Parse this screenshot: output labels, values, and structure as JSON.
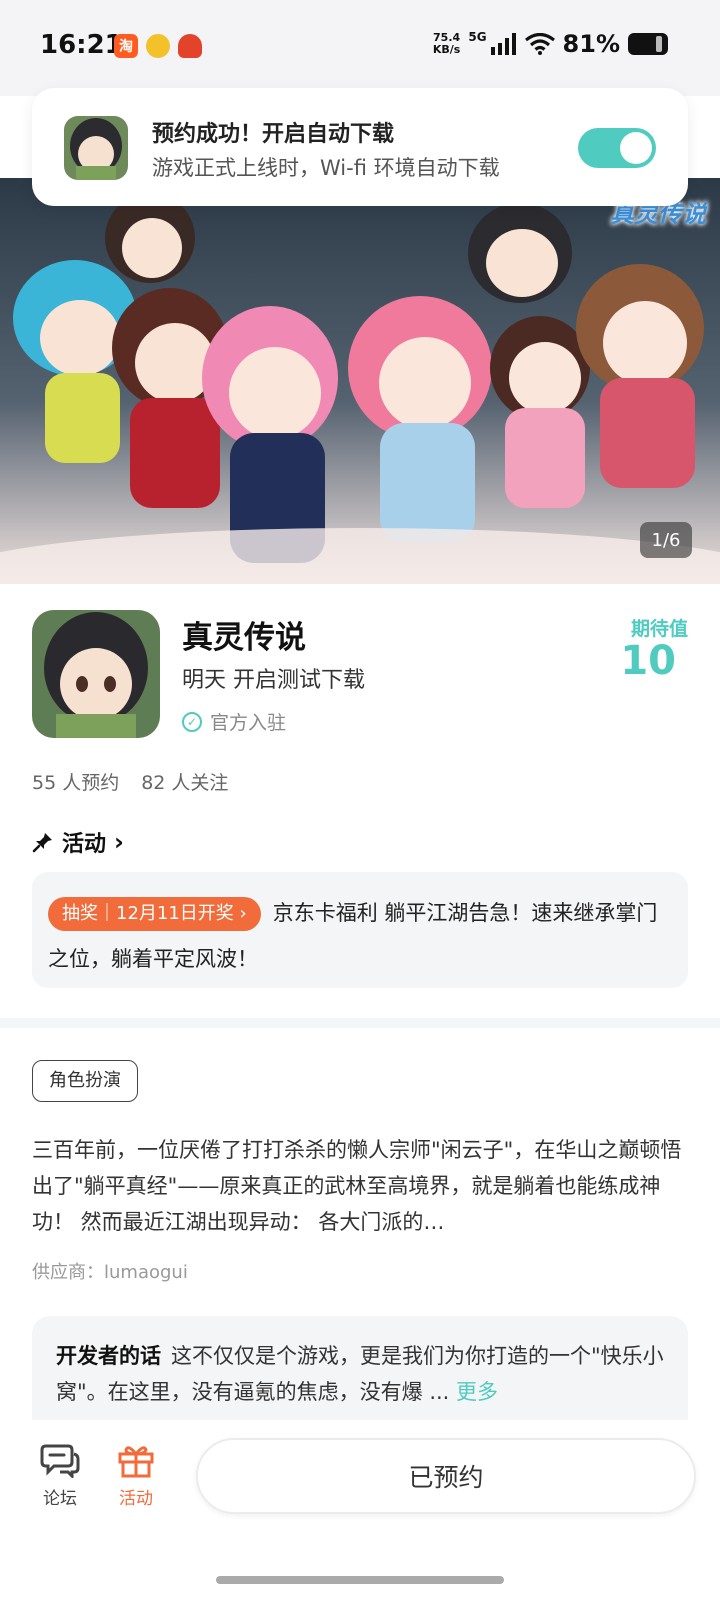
{
  "status_bar": {
    "time": "16:21",
    "speed_value": "75.4",
    "speed_unit": "KB/s",
    "network": "5G",
    "battery": "81%"
  },
  "notification": {
    "title": "预约成功！开启自动下载",
    "subtitle": "游戏正式上线时，Wi-fi 环境自动下载",
    "toggle_on": true,
    "accent": "#4fcbbf"
  },
  "banner": {
    "logo_text": "真灵传说",
    "pager": "1/6"
  },
  "game": {
    "name": "真灵传说",
    "status": "明天 开启测试下载",
    "official_label": "官方入驻",
    "expect_label": "期待值",
    "expect_value": "10",
    "reservations": "55 人预约",
    "followers": "82 人关注"
  },
  "activity": {
    "heading": "活动",
    "tag": "抽奖｜12月11日开奖",
    "text": "京东卡福利 躺平江湖告急！速来继承掌门之位，躺着平定风波！",
    "tag_color": "#f26b3a"
  },
  "details": {
    "genre_tag": "角色扮演",
    "description": "三百年前，一位厌倦了打打杀杀的懒人宗师\"闲云子\"，在华山之巅顿悟出了\"躺平真经\"——原来真正的武林至高境界，就是躺着也能练成神功！ 然而最近江湖出现异动： 各大门派的…",
    "supplier": "供应商：lumaogui"
  },
  "developer_note": {
    "title": "开发者的话",
    "text": "这不仅仅是个游戏，更是我们为你打造的一个\"快乐小窝\"。在这里，没有逼氪的焦虑，没有爆 ...",
    "more": "更多"
  },
  "bottom_nav": {
    "forum_label": "论坛",
    "activity_label": "活动",
    "reserve_button": "已预约",
    "active_color": "#f26b3a"
  }
}
